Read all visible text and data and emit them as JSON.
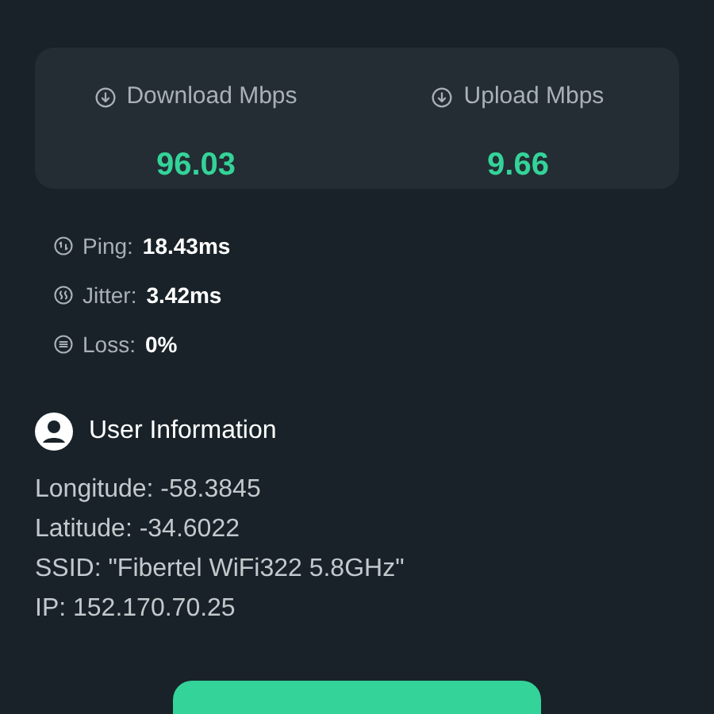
{
  "speed": [
    {
      "label": "Download Mbps",
      "value": "96.03"
    },
    {
      "label": "Upload Mbps",
      "value": "9.66"
    }
  ],
  "metrics": [
    {
      "kind": "ping",
      "label": "Ping:",
      "value": "18.43ms"
    },
    {
      "kind": "jitter",
      "label": "Jitter:",
      "value": "3.42ms"
    },
    {
      "kind": "loss",
      "label": "Loss:",
      "value": "0%"
    }
  ],
  "user_information": {
    "title": "User Information",
    "lines": [
      "Longitude: -58.3845",
      "Latitude: -34.6022",
      "SSID: \"Fibertel WiFi322 5.8GHz\"",
      "IP: 152.170.70.25"
    ]
  }
}
